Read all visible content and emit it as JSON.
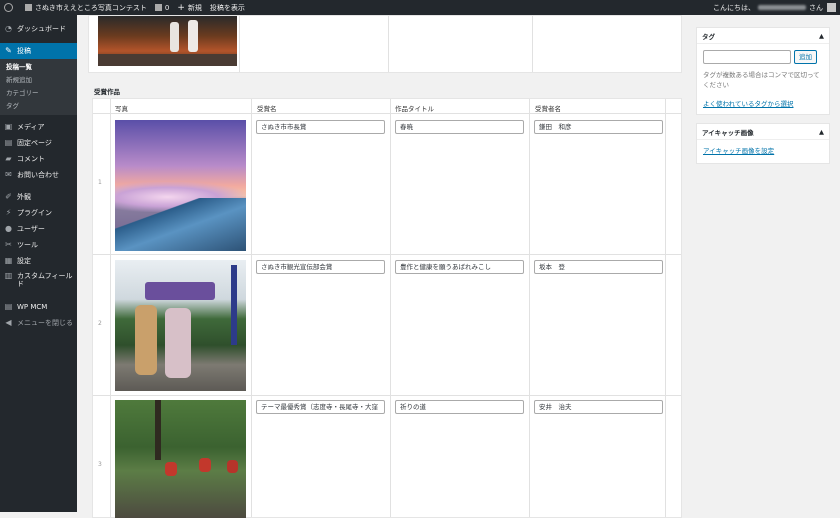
{
  "admin_bar": {
    "site_name": "さぬき市ええところ写真コンテスト",
    "comments_count": "0",
    "new_label": "新規",
    "view_post_label": "投稿を表示",
    "greeting_prefix": "こんにちは、",
    "greeting_suffix": "さん"
  },
  "sidebar": {
    "dashboard": "ダッシュボード",
    "posts": "投稿",
    "posts_submenu": [
      "投稿一覧",
      "新規追加",
      "カテゴリー",
      "タグ"
    ],
    "items": [
      "メディア",
      "固定ページ",
      "コメント",
      "お問い合わせ"
    ],
    "items2": [
      "外観",
      "プラグイン",
      "ユーザー",
      "ツール",
      "設定",
      "カスタムフィールド"
    ],
    "wpmcm": "WP MCM",
    "collapse": "メニューを閉じる"
  },
  "awards": {
    "section_title": "受賞作品",
    "headers": [
      "写真",
      "受賞名",
      "作品タイトル",
      "受賞者名"
    ],
    "rows": [
      {
        "num": "1",
        "award": "さぬき市市長賞",
        "title": "春暁",
        "winner": "鎌田　和彦"
      },
      {
        "num": "2",
        "award": "さぬき市観光宣伝部会賞",
        "title": "豊作と健康を願うあばれみこし",
        "winner": "坂本　登"
      },
      {
        "num": "3",
        "award": "テーマ最優秀賞（志度寺・長尾寺・大窪",
        "title": "祈りの道",
        "winner": "安井　治夫"
      }
    ]
  },
  "tags_box": {
    "title": "タグ",
    "add_button": "追加",
    "help_text": "タグが複数ある場合はコンマで区切ってください",
    "popular_link": "よく使われているタグから選択"
  },
  "featured_box": {
    "title": "アイキャッチ画像",
    "set_link": "アイキャッチ画像を設定"
  },
  "colors": {
    "accent": "#0073aa",
    "admin_dark": "#23282d"
  }
}
